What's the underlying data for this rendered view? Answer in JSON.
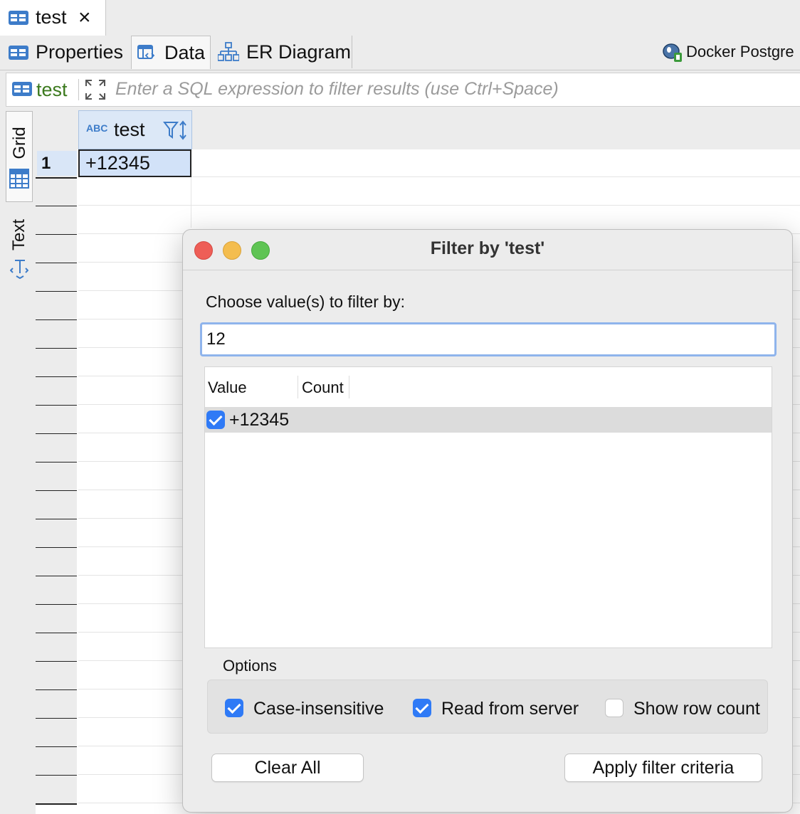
{
  "editor_tab": {
    "label": "test",
    "close_symbol": "×"
  },
  "sub_tabs": [
    {
      "label": "Properties",
      "icon": "table-icon"
    },
    {
      "label": "Data",
      "icon": "data-icon"
    },
    {
      "label": "ER Diagram",
      "icon": "er-diagram-icon"
    }
  ],
  "connection": {
    "label": "Docker Postgre"
  },
  "filter_bar": {
    "table_label": "test",
    "placeholder": "Enter a SQL expression to filter results (use Ctrl+Space)"
  },
  "view_tabs": {
    "grid": "Grid",
    "text": "Text"
  },
  "grid": {
    "column_type": "ABC",
    "column_name": "test",
    "rows": [
      {
        "num": "1",
        "value": "+12345"
      }
    ]
  },
  "dialog": {
    "title": "Filter by 'test'",
    "prompt": "Choose value(s) to filter by:",
    "search_value": "12",
    "list_headers": {
      "value": "Value",
      "count": "Count"
    },
    "list_items": [
      {
        "value": "+12345",
        "checked": true
      }
    ],
    "options_label": "Options",
    "options": {
      "case_insensitive": "Case-insensitive",
      "read_from_server": "Read from server",
      "show_row_count": "Show row count"
    },
    "clear_button": "Clear All",
    "apply_button": "Apply filter criteria"
  },
  "colors": {
    "accent": "#2f7af6",
    "selection": "#d2e2f8",
    "icon_blue": "#3d7cc9",
    "filter_green": "#3c7a1e"
  }
}
